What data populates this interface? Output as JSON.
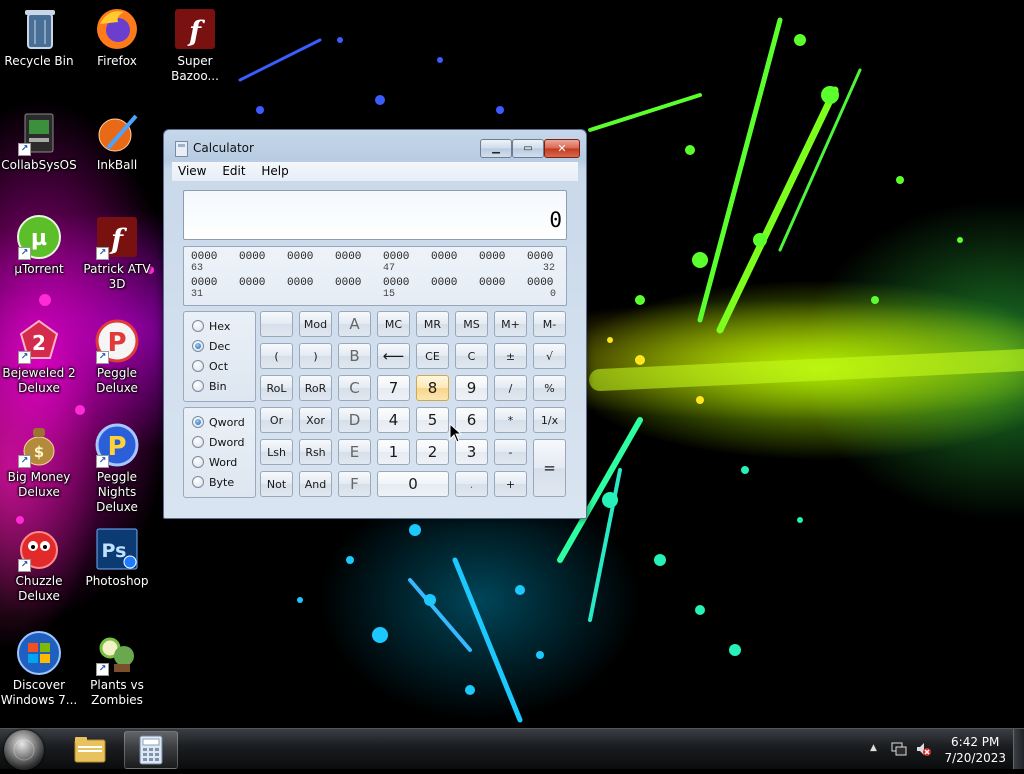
{
  "desktop": {
    "icons": [
      {
        "label": "Recycle Bin",
        "icon": "recycle-bin-icon"
      },
      {
        "label": "Firefox",
        "icon": "firefox-icon"
      },
      {
        "label": "Super Bazoo...",
        "icon": "flash-icon"
      },
      {
        "label": "CollabSysOS",
        "icon": "collabsysos-icon"
      },
      {
        "label": "InkBall",
        "icon": "inkball-icon"
      },
      {
        "label": "µTorrent",
        "icon": "utorrent-icon"
      },
      {
        "label": "Patrick ATV 3D",
        "icon": "flash-icon"
      },
      {
        "label": "Bejeweled 2 Deluxe",
        "icon": "bejeweled-icon"
      },
      {
        "label": "Peggle Deluxe",
        "icon": "peggle-icon"
      },
      {
        "label": "Big Money Deluxe",
        "icon": "money-bag-icon"
      },
      {
        "label": "Peggle Nights Deluxe",
        "icon": "peggle-nights-icon"
      },
      {
        "label": "Chuzzle Deluxe",
        "icon": "chuzzle-icon"
      },
      {
        "label": "Photoshop",
        "icon": "photoshop-icon"
      },
      {
        "label": "Discover Windows 7...",
        "icon": "windows-logo-icon"
      },
      {
        "label": "Plants vs Zombies",
        "icon": "plants-vs-zombies-icon"
      }
    ]
  },
  "calculator": {
    "title": "Calculator",
    "menu": [
      "View",
      "Edit",
      "Help"
    ],
    "display": "0",
    "bits": {
      "row1": [
        "0000",
        "0000",
        "0000",
        "0000",
        "0000",
        "0000",
        "0000",
        "0000"
      ],
      "row1_nums": [
        "63",
        "47",
        "32"
      ],
      "row2": [
        "0000",
        "0000",
        "0000",
        "0000",
        "0000",
        "0000",
        "0000",
        "0000"
      ],
      "row2_nums": [
        "31",
        "15",
        "0"
      ]
    },
    "base_options": [
      "Hex",
      "Dec",
      "Oct",
      "Bin"
    ],
    "base_selected": "Dec",
    "word_options": [
      "Qword",
      "Dword",
      "Word",
      "Byte"
    ],
    "word_selected": "Qword",
    "keys": {
      "mod": "Mod",
      "A": "A",
      "MC": "MC",
      "MR": "MR",
      "MS": "MS",
      "Mplus": "M+",
      "Mminus": "M-",
      "lparen": "(",
      "rparen": ")",
      "B": "B",
      "back": "⟵",
      "CE": "CE",
      "C": "C",
      "pm": "±",
      "sqrt": "√",
      "RoL": "RoL",
      "RoR": "RoR",
      "Chex": "C",
      "seven": "7",
      "eight": "8",
      "nine": "9",
      "div": "/",
      "pct": "%",
      "Or": "Or",
      "Xor": "Xor",
      "D": "D",
      "four": "4",
      "five": "5",
      "six": "6",
      "mul": "*",
      "recip": "1/x",
      "Lsh": "Lsh",
      "Rsh": "Rsh",
      "E": "E",
      "one": "1",
      "two": "2",
      "three": "3",
      "minus": "-",
      "equals": "=",
      "Not": "Not",
      "And": "And",
      "F": "F",
      "zero": "0",
      "dot": ".",
      "plus": "+"
    }
  },
  "taskbar": {
    "time": "6:42 PM",
    "date": "7/20/2023",
    "tray_arrow": "▲"
  }
}
